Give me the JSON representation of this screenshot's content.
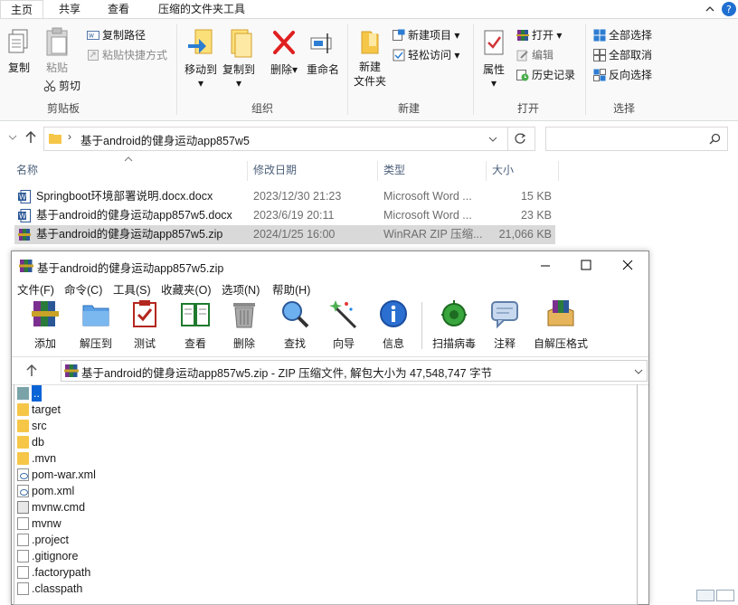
{
  "ribbon_tabs": [
    "主页",
    "共享",
    "查看",
    "压缩的文件夹工具"
  ],
  "clipboard": {
    "copy": "复制",
    "paste": "粘贴",
    "copy_path": "复制路径",
    "paste_shortcut": "粘贴快捷方式",
    "cut": "剪切",
    "group": "剪贴板"
  },
  "organize": {
    "move_to": "移动到",
    "copy_to": "复制到",
    "delete": "删除",
    "rename": "重命名",
    "group": "组织"
  },
  "new_group": {
    "new_folder": "新建\n文件夹",
    "new_item": "新建项目",
    "easy_access": "轻松访问",
    "group": "新建"
  },
  "open_group": {
    "properties": "属性",
    "open": "打开",
    "edit": "编辑",
    "history": "历史记录",
    "group": "打开"
  },
  "select_group": {
    "select_all": "全部选择",
    "select_none": "全部取消",
    "invert": "反向选择",
    "group": "选择"
  },
  "address": {
    "path": "基于android的健身运动app857w5",
    "search_placeholder": ""
  },
  "columns": [
    "名称",
    "修改日期",
    "类型",
    "大小"
  ],
  "files": [
    {
      "name": "Springboot环境部署说明.docx.docx",
      "date": "2023/12/30 21:23",
      "type": "Microsoft Word ...",
      "size": "15 KB",
      "icon": "word-icon"
    },
    {
      "name": "基于android的健身运动app857w5.docx",
      "date": "2023/6/19 20:11",
      "type": "Microsoft Word ...",
      "size": "23 KB",
      "icon": "word-icon"
    },
    {
      "name": "基于android的健身运动app857w5.zip",
      "date": "2024/1/25 16:00",
      "type": "WinRAR ZIP 压缩...",
      "size": "21,066 KB",
      "icon": "winrar-icon"
    }
  ],
  "rar": {
    "title": "基于android的健身运动app857w5.zip",
    "menu": [
      "文件(F)",
      "命令(C)",
      "工具(S)",
      "收藏夹(O)",
      "选项(N)",
      "帮助(H)"
    ],
    "toolbar": [
      "添加",
      "解压到",
      "测试",
      "查看",
      "删除",
      "查找",
      "向导",
      "信息",
      "扫描病毒",
      "注释",
      "自解压格式"
    ],
    "path_text": "基于android的健身运动app857w5.zip - ZIP 压缩文件, 解包大小为 47,548,747 字节",
    "items": [
      {
        "name": "..",
        "kind": "up"
      },
      {
        "name": "target",
        "kind": "folder"
      },
      {
        "name": "src",
        "kind": "folder"
      },
      {
        "name": "db",
        "kind": "folder"
      },
      {
        "name": ".mvn",
        "kind": "folder"
      },
      {
        "name": "pom-war.xml",
        "kind": "xml"
      },
      {
        "name": "pom.xml",
        "kind": "xml"
      },
      {
        "name": "mvnw.cmd",
        "kind": "cmd"
      },
      {
        "name": "mvnw",
        "kind": "file"
      },
      {
        "name": ".project",
        "kind": "file"
      },
      {
        "name": ".gitignore",
        "kind": "file"
      },
      {
        "name": ".factorypath",
        "kind": "file"
      },
      {
        "name": ".classpath",
        "kind": "file"
      }
    ]
  }
}
